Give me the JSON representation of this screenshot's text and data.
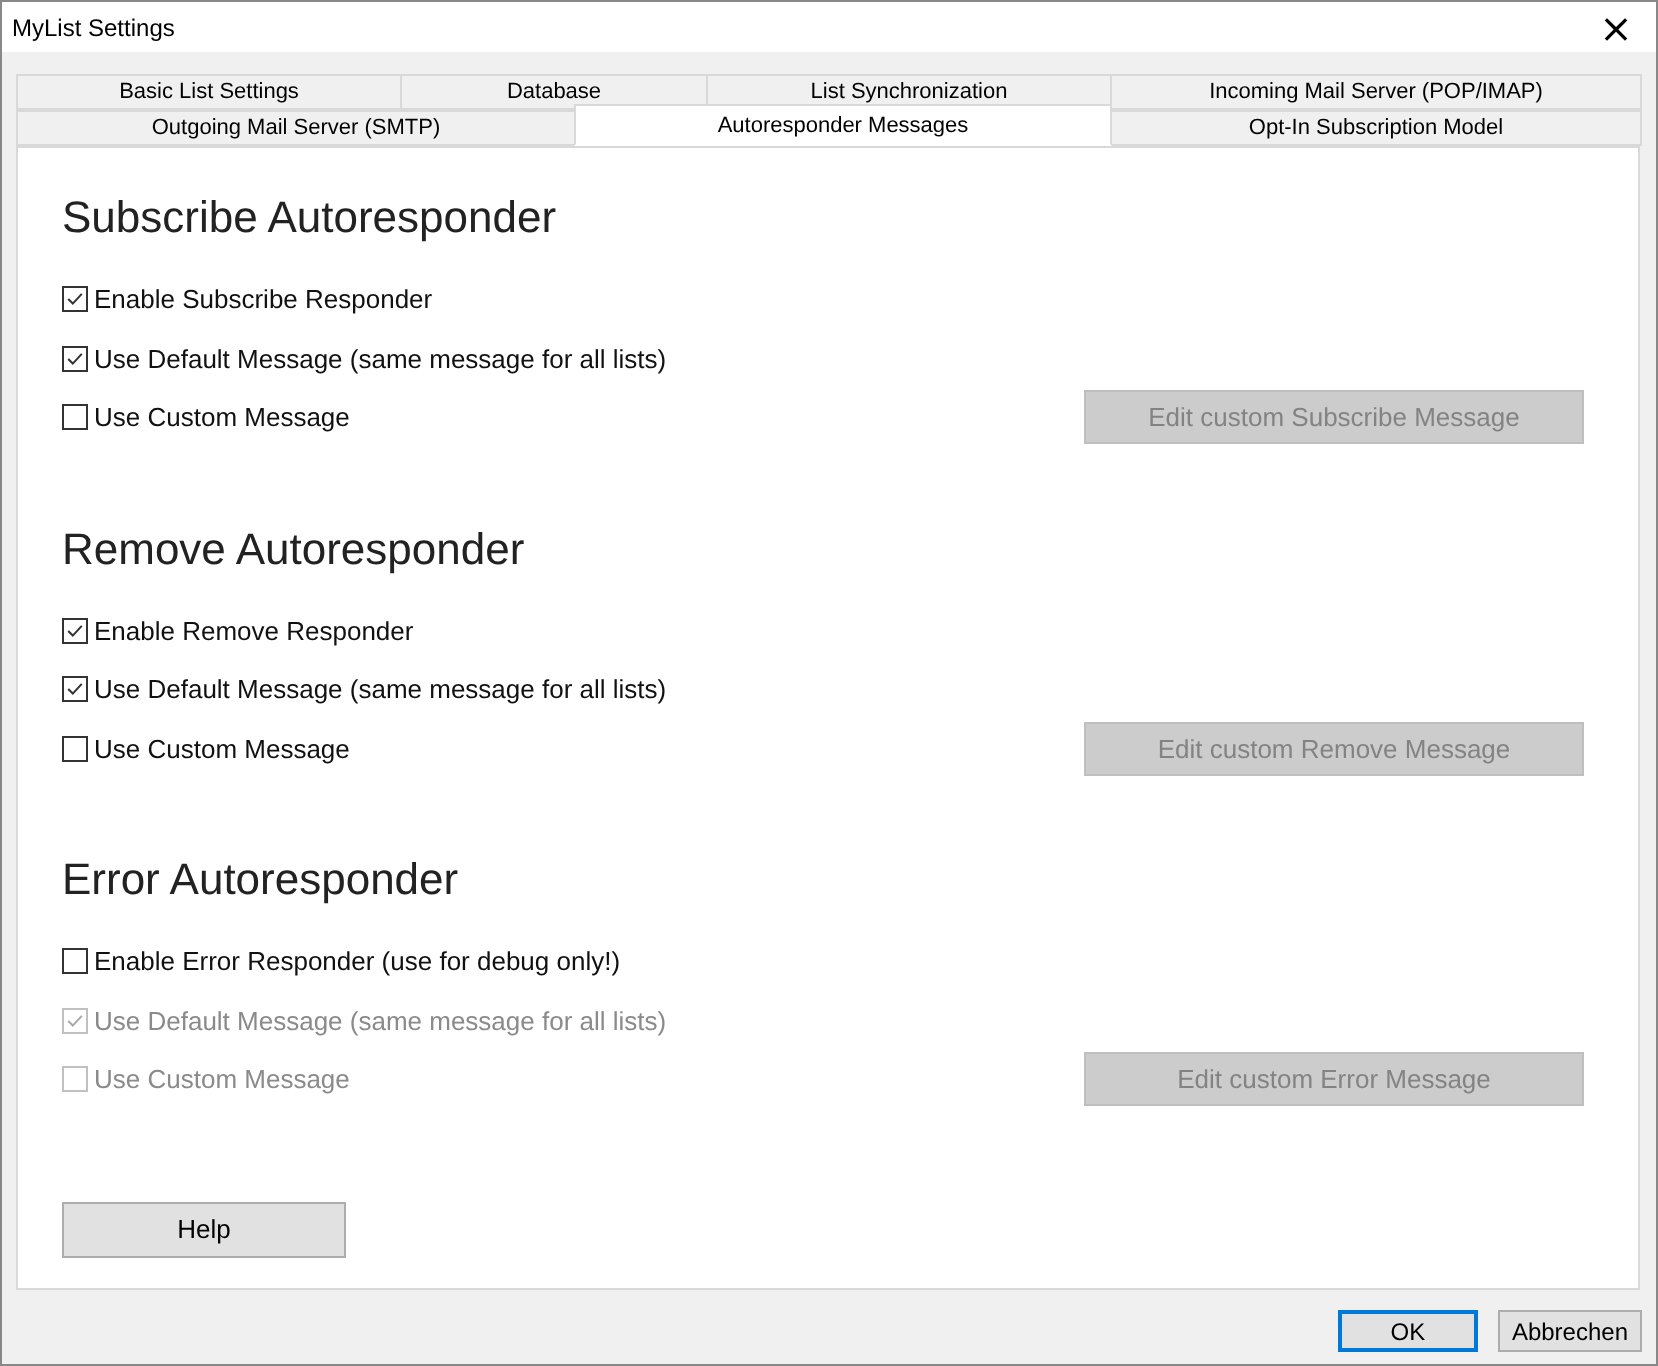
{
  "window": {
    "title": "MyList Settings",
    "close": "×"
  },
  "tab_rows": [
    [
      {
        "label": "Basic List Settings",
        "selected": false
      },
      {
        "label": "Database",
        "selected": false
      },
      {
        "label": "List Synchronization",
        "selected": false
      },
      {
        "label": "Incoming Mail Server (POP/IMAP)",
        "selected": false
      }
    ],
    [
      {
        "label": "Outgoing Mail Server (SMTP)",
        "selected": false
      },
      {
        "label": "Autoresponder Messages",
        "selected": true
      },
      {
        "label": "Opt-In Subscription Model",
        "selected": false
      }
    ]
  ],
  "sections": [
    {
      "title": "Subscribe Autoresponder",
      "options": [
        {
          "label": "Enable Subscribe Responder",
          "checked": true,
          "disabled": false
        },
        {
          "label": "Use Default Message (same message for all lists)",
          "checked": true,
          "disabled": false
        },
        {
          "label": "Use Custom Message",
          "checked": false,
          "disabled": false
        }
      ],
      "button": {
        "label": "Edit custom Subscribe Message",
        "disabled": true
      }
    },
    {
      "title": "Remove Autoresponder",
      "options": [
        {
          "label": "Enable Remove Responder",
          "checked": true,
          "disabled": false
        },
        {
          "label": "Use Default Message (same message for all lists)",
          "checked": true,
          "disabled": false
        },
        {
          "label": "Use Custom Message",
          "checked": false,
          "disabled": false
        }
      ],
      "button": {
        "label": "Edit custom Remove Message",
        "disabled": true
      }
    },
    {
      "title": "Error Autoresponder",
      "options": [
        {
          "label": "Enable Error Responder (use for debug only!)",
          "checked": false,
          "disabled": false
        },
        {
          "label": "Use Default Message (same message for all lists)",
          "checked": true,
          "disabled": true
        },
        {
          "label": "Use Custom Message",
          "checked": false,
          "disabled": true
        }
      ],
      "button": {
        "label": "Edit custom Error Message",
        "disabled": true
      }
    }
  ],
  "help_button": "Help",
  "footer_buttons": [
    {
      "label": "OK",
      "selected": true
    },
    {
      "label": "Abbrechen",
      "selected": false
    }
  ]
}
